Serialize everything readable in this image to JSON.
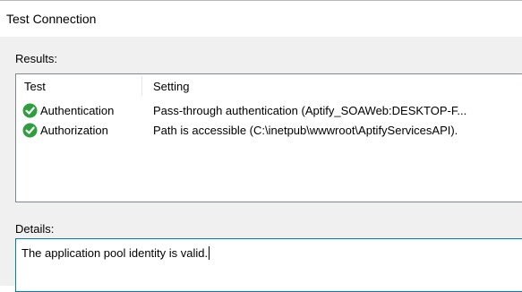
{
  "dialog": {
    "title": "Test Connection"
  },
  "results": {
    "label": "Results:",
    "columns": {
      "test": "Test",
      "setting": "Setting"
    },
    "rows": [
      {
        "icon": "success-check-icon",
        "test": "Authentication",
        "setting": "Pass-through authentication (Aptify_SOAWeb:DESKTOP-F..."
      },
      {
        "icon": "success-check-icon",
        "test": "Authorization",
        "setting": "Path is accessible (C:\\inetpub\\wwwroot\\AptifyServicesAPI)."
      }
    ]
  },
  "details": {
    "label": "Details:",
    "text": "The application pool identity is valid."
  },
  "colors": {
    "success": "#2e9e3f",
    "focus_border": "#0078d7"
  }
}
